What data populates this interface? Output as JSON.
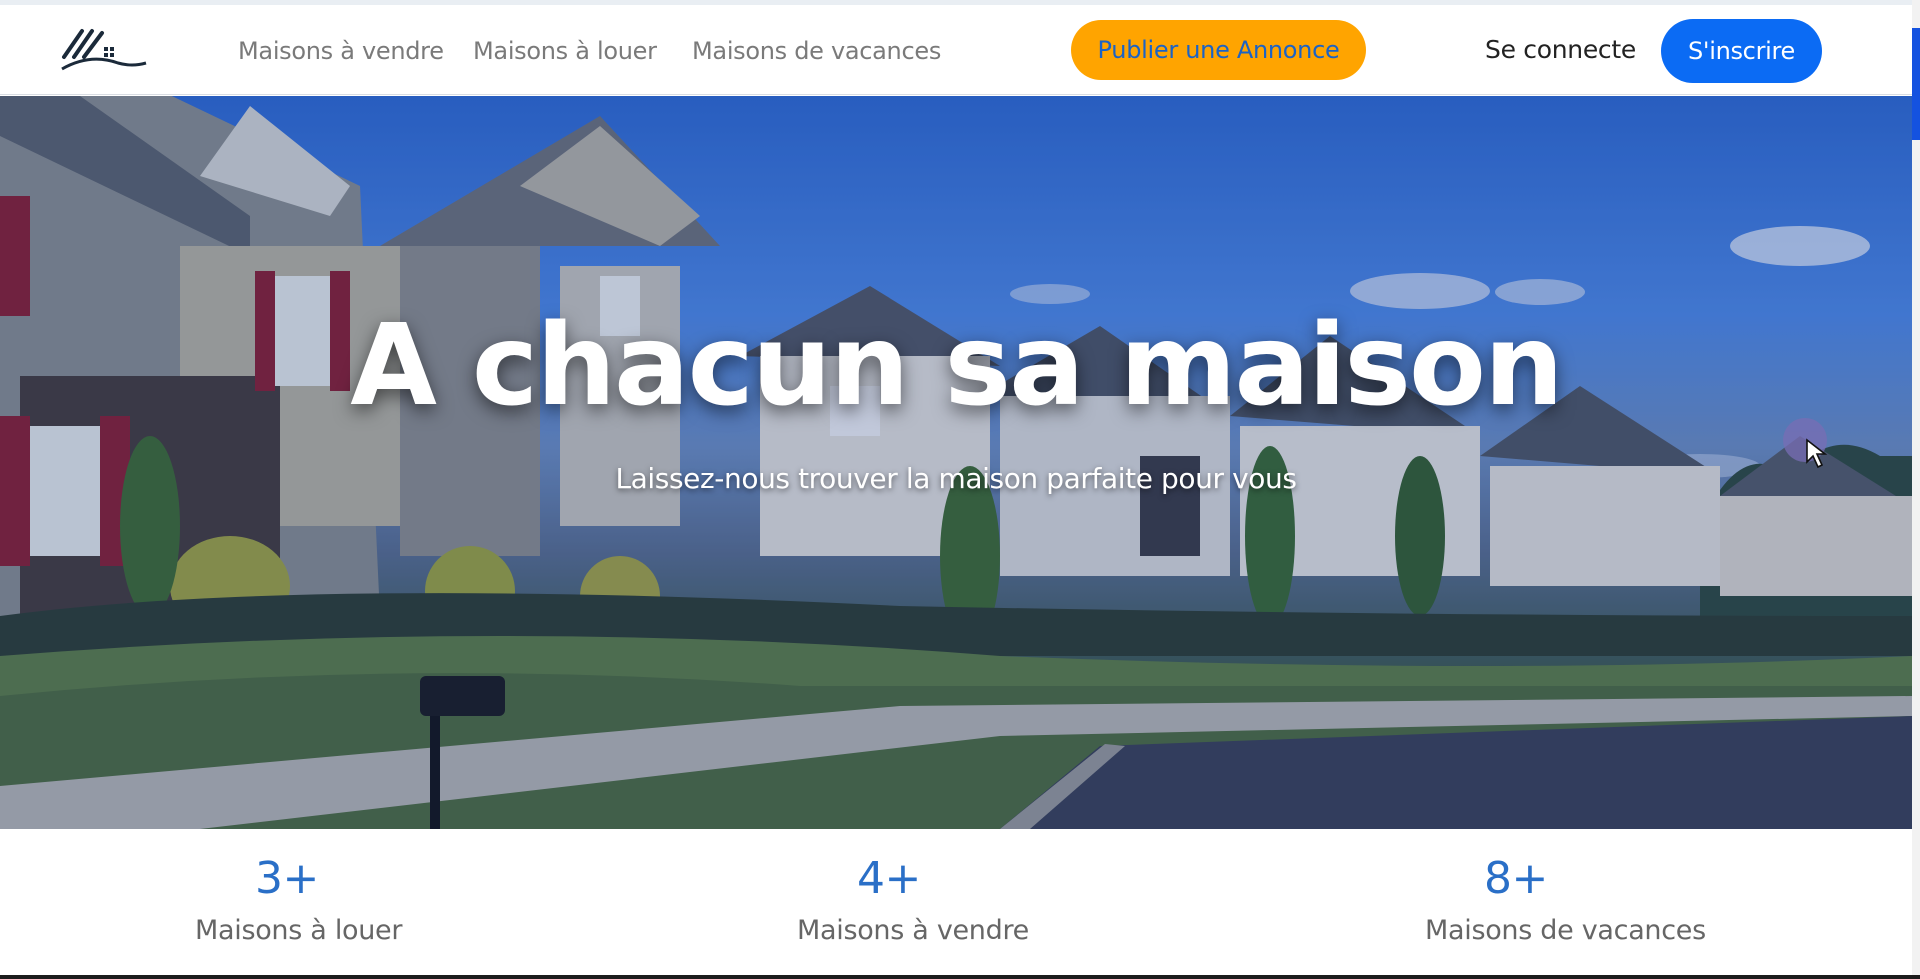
{
  "header": {
    "logo_icon": "house-logo-icon",
    "nav": [
      {
        "label": "Maisons à vendre"
      },
      {
        "label": "Maisons à louer"
      },
      {
        "label": "Maisons de vacances"
      }
    ],
    "publish_label": "Publier une Annonce",
    "login_label": "Se connecte",
    "signup_label": "S'inscrire"
  },
  "hero": {
    "title": "A chacun sa maison",
    "subtitle": "Laissez-nous trouver la maison parfaite pour vous"
  },
  "stats": [
    {
      "value": "3+",
      "label": "Maisons à louer"
    },
    {
      "value": "4+",
      "label": "Maisons à vendre"
    },
    {
      "value": "8+",
      "label": "Maisons de vacances"
    }
  ],
  "colors": {
    "publish_bg": "#ffa400",
    "signup_bg": "#0b6bf4",
    "stat_value": "#2a6fc7"
  }
}
